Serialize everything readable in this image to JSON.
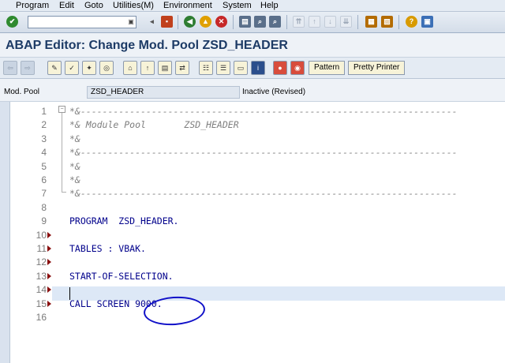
{
  "menu": [
    "Program",
    "Edit",
    "Goto",
    "Utilities(M)",
    "Environment",
    "System",
    "Help"
  ],
  "toolbar": {
    "command_value": ""
  },
  "title": "ABAP Editor: Change Mod. Pool ZSD_HEADER",
  "app_toolbar": {
    "pattern_label": "Pattern",
    "pretty_printer_label": "Pretty Printer"
  },
  "program_header": {
    "label": "Mod. Pool",
    "name": "ZSD_HEADER",
    "status": "Inactive (Revised)"
  },
  "editor": {
    "line_numbers": [
      "1",
      "2",
      "3",
      "4",
      "5",
      "6",
      "7",
      "8",
      "9",
      "10",
      "11",
      "12",
      "13",
      "14",
      "15",
      "16"
    ],
    "code_lines": [
      {
        "text": "*&---------------------------------------------------------------------",
        "comment": true
      },
      {
        "text": "*& Module Pool       ZSD_HEADER",
        "comment": true
      },
      {
        "text": "*&",
        "comment": true
      },
      {
        "text": "*&---------------------------------------------------------------------",
        "comment": true
      },
      {
        "text": "*&",
        "comment": true
      },
      {
        "text": "*&",
        "comment": true
      },
      {
        "text": "*&---------------------------------------------------------------------",
        "comment": true
      },
      {
        "text": "",
        "comment": false
      },
      {
        "text": "PROGRAM  ZSD_HEADER.",
        "comment": false
      },
      {
        "text": "",
        "comment": false
      },
      {
        "text": "TABLES : VBAK.",
        "comment": false
      },
      {
        "text": "",
        "comment": false
      },
      {
        "text": "START-OF-SELECTION.",
        "comment": false
      },
      {
        "text": "",
        "comment": false
      },
      {
        "text": "CALL SCREEN 9000.",
        "comment": false
      },
      {
        "text": "",
        "comment": false
      }
    ],
    "block_markers": [
      "10",
      "11",
      "12",
      "13",
      "14",
      "15"
    ],
    "current_line": "14",
    "marker_color": "#8a1010",
    "code_color": "#00008b",
    "comment_color": "#7f7f7f"
  }
}
